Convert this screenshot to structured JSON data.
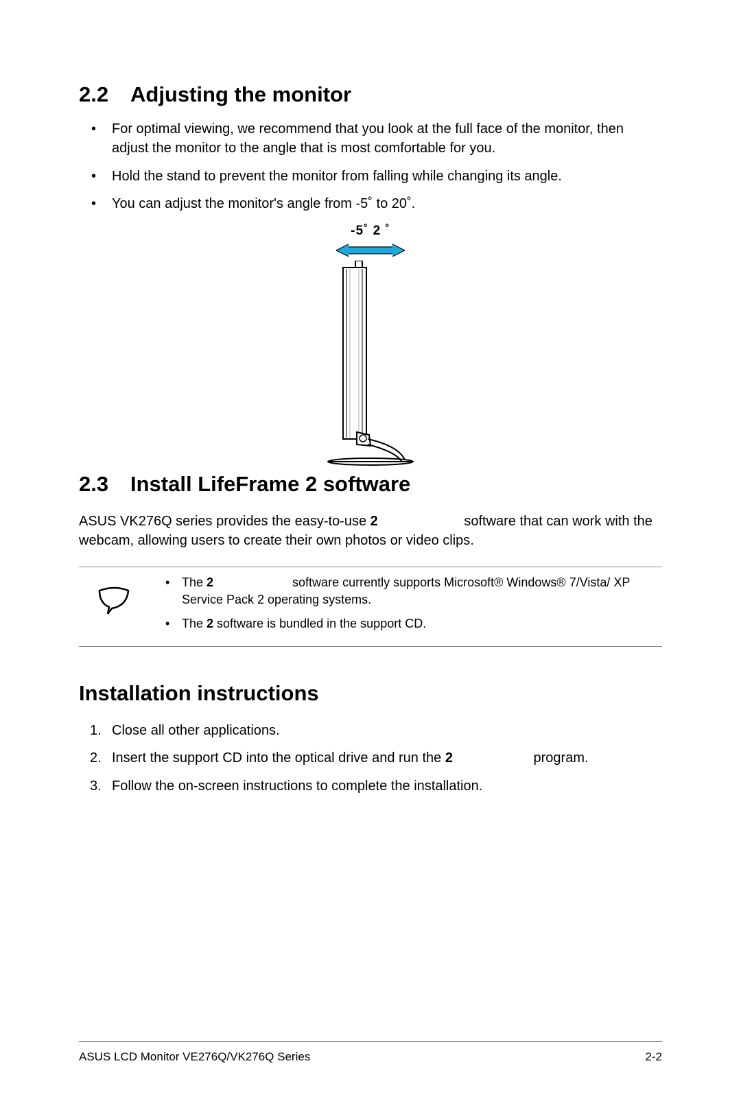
{
  "section1": {
    "num": "2.2",
    "title": "Adjusting the monitor",
    "bullets": [
      "For optimal viewing, we recommend that you look at the full face of the monitor, then adjust the monitor to the angle that is most comfortable for you.",
      "Hold the stand to prevent the monitor from falling while changing its angle.",
      "You can adjust the monitor's angle from -5˚ to 20˚."
    ]
  },
  "diagram": {
    "angle_label": "-5˚ 2    ˚"
  },
  "section2": {
    "num": "2.3",
    "title": "Install LifeFrame 2 software",
    "para_parts": {
      "p1": "ASUS VK276Q series provides the easy-to-use ",
      "b1": "2",
      "p2": " software that can work with the webcam, allowing users to create their own photos or video clips."
    }
  },
  "note": {
    "items": [
      {
        "pre": "The ",
        "b": "2",
        "post": " software currently supports Microsoft® Windows® 7/Vista/ XP Service Pack 2 operating systems."
      },
      {
        "pre": "The ",
        "b": "2",
        "post": " software is bundled in the support CD."
      }
    ]
  },
  "section3": {
    "title": "Installation instructions",
    "steps": [
      {
        "pre": "Close all other applications.",
        "b": "",
        "post": ""
      },
      {
        "pre": "Insert the support CD into the optical drive and run the ",
        "b": "2",
        "post": " program."
      },
      {
        "pre": "Follow the on-screen instructions to complete the installation.",
        "b": "",
        "post": ""
      }
    ]
  },
  "footer": {
    "left": "ASUS LCD Monitor VE276Q/VK276Q Series",
    "right": "2-2"
  }
}
